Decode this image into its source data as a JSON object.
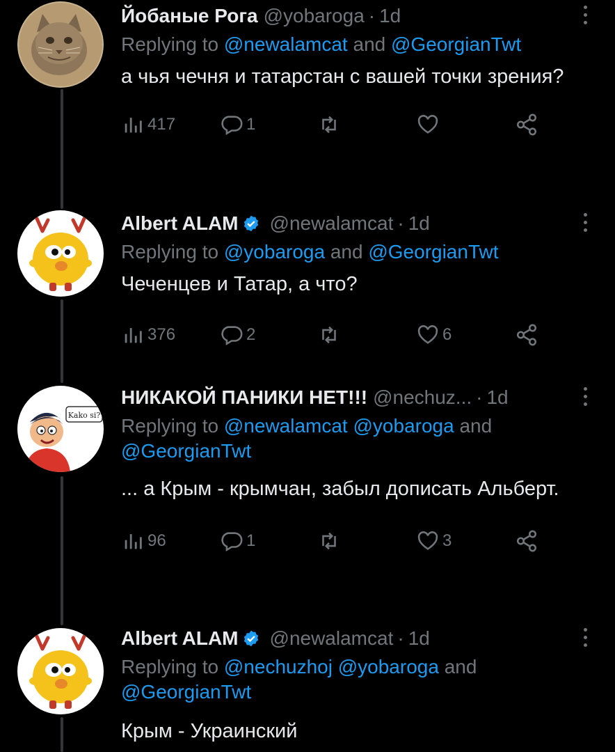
{
  "tweets": [
    {
      "name": "Йобаные Рога",
      "verified": false,
      "handle": "@yobaroga",
      "dot": "·",
      "time": "1d",
      "replying_prefix": "Replying to ",
      "mentions_line": [
        {
          "t": "@newalamcat",
          "m": true
        },
        {
          "t": " and ",
          "m": false
        },
        {
          "t": "@GeorgianTwt",
          "m": true
        }
      ],
      "text": "а чья чечня и татарстан с вашей точки зрения?",
      "views": "417",
      "replies": "1",
      "retweets": "",
      "likes": "",
      "avatar": "cat-photo"
    },
    {
      "name": "Albert ALAM",
      "verified": true,
      "handle": "@newalamcat",
      "dot": "·",
      "time": "1d",
      "replying_prefix": "Replying to ",
      "mentions_line": [
        {
          "t": "@yobaroga",
          "m": true
        },
        {
          "t": " and ",
          "m": false
        },
        {
          "t": "@GeorgianTwt",
          "m": true
        }
      ],
      "text": "Чеченцев и Татар, а что?",
      "views": "376",
      "replies": "2",
      "retweets": "",
      "likes": "6",
      "avatar": "yellow-creature"
    },
    {
      "name": "НИКАКОЙ ПАНИКИ НЕТ!!!",
      "verified": false,
      "handle": "@nechuz...",
      "dot": "·",
      "time": "1d",
      "replying_prefix": "Replying to ",
      "mentions_line": [
        {
          "t": "@newalamcat",
          "m": true
        },
        {
          "t": " ",
          "m": false
        },
        {
          "t": "@yobaroga",
          "m": true
        },
        {
          "t": " and ",
          "m": false
        },
        {
          "t": "@GeorgianTwt",
          "m": true
        }
      ],
      "text": "... а Крым - крымчан, забыл дописать Альберт.",
      "views": "96",
      "replies": "1",
      "retweets": "",
      "likes": "3",
      "avatar": "cartoon-boy",
      "avatar_bubble": "Kako si?"
    },
    {
      "name": "Albert ALAM",
      "verified": true,
      "handle": "@newalamcat",
      "dot": "·",
      "time": "1d",
      "replying_prefix": "Replying to ",
      "mentions_line": [
        {
          "t": "@nechuzhoj",
          "m": true
        },
        {
          "t": " ",
          "m": false
        },
        {
          "t": "@yobaroga",
          "m": true
        },
        {
          "t": " and ",
          "m": false
        },
        {
          "t": "@GeorgianTwt",
          "m": true
        }
      ],
      "text": "Крым - Украинский",
      "avatar": "yellow-creature"
    }
  ],
  "colors": {
    "background": "#000000",
    "text": "#e7e9ea",
    "muted": "#71767b",
    "mention": "#1d9bf0",
    "verified": "#1d9bf0",
    "thread_line": "#333639"
  },
  "icons": {
    "views": "views-bar-chart-icon",
    "reply": "reply-bubble-icon",
    "retweet": "retweet-icon",
    "like": "heart-icon",
    "share": "share-nodes-icon",
    "more": "more-dots-icon",
    "verified": "verified-badge-icon"
  }
}
